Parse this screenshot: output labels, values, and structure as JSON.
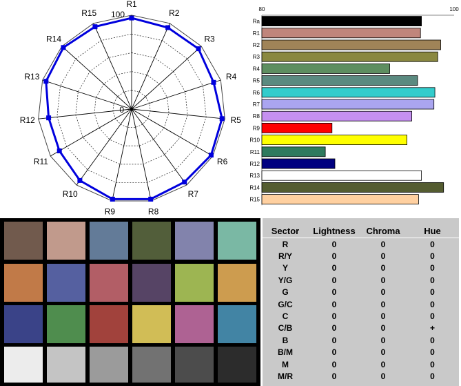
{
  "chart_data": [
    {
      "type": "radar",
      "axes": [
        "R1",
        "R2",
        "R3",
        "R4",
        "R5",
        "R6",
        "R7",
        "R8",
        "R9",
        "R10",
        "R11",
        "R12",
        "R13",
        "R14",
        "R15"
      ],
      "values": [
        97,
        95,
        96,
        92,
        97,
        98,
        96,
        98,
        98,
        94,
        89,
        89,
        96,
        98,
        96
      ],
      "max_label": "100",
      "center_label": "0",
      "range": [
        0,
        100
      ],
      "series_color": "#0000dd"
    },
    {
      "type": "bar",
      "orientation": "horizontal",
      "categories": [
        "Ra",
        "R1",
        "R2",
        "R3",
        "R4",
        "R5",
        "R6",
        "R7",
        "R8",
        "R9",
        "R10",
        "R11",
        "R12",
        "R13",
        "R14",
        "R15"
      ],
      "values": [
        96.6,
        96.5,
        98.6,
        98.3,
        93.3,
        96.2,
        98.0,
        97.9,
        95.6,
        87.3,
        95.1,
        86.6,
        87.6,
        96.6,
        98.9,
        96.3
      ],
      "colors": [
        "#000000",
        "#c0857b",
        "#a08458",
        "#8a8840",
        "#5e8e60",
        "#5b8a80",
        "#33cccc",
        "#aaa5f0",
        "#c590f0",
        "#ff0000",
        "#ffff00",
        "#2e7a5e",
        "#000080",
        "#ffffff",
        "#545c30",
        "#ffd0a0"
      ],
      "xlim": [
        80,
        100
      ],
      "tick_labels": [
        "80",
        "100"
      ]
    }
  ],
  "swatches": [
    "#715a4d",
    "#c19a8c",
    "#637b98",
    "#525e3a",
    "#8283ac",
    "#7ab8a4",
    "#c17a48",
    "#5560a0",
    "#b25e66",
    "#564465",
    "#9db552",
    "#cd9c4f",
    "#3a4388",
    "#4f8d4e",
    "#a1423c",
    "#d1bd56",
    "#ae6293",
    "#4284a4",
    "#ececec",
    "#c4c4c4",
    "#9b9b9b",
    "#727272",
    "#4c4c4c",
    "#2c2c2c"
  ],
  "sector_table": {
    "headers": [
      "Sector",
      "Lightness",
      "Chroma",
      "Hue"
    ],
    "rows": [
      [
        "R",
        "0",
        "0",
        "0"
      ],
      [
        "R/Y",
        "0",
        "0",
        "0"
      ],
      [
        "Y",
        "0",
        "0",
        "0"
      ],
      [
        "Y/G",
        "0",
        "0",
        "0"
      ],
      [
        "G",
        "0",
        "0",
        "0"
      ],
      [
        "G/C",
        "0",
        "0",
        "0"
      ],
      [
        "C",
        "0",
        "0",
        "0"
      ],
      [
        "C/B",
        "0",
        "0",
        "+"
      ],
      [
        "B",
        "0",
        "0",
        "0"
      ],
      [
        "B/M",
        "0",
        "0",
        "0"
      ],
      [
        "M",
        "0",
        "0",
        "0"
      ],
      [
        "M/R",
        "0",
        "0",
        "0"
      ]
    ]
  }
}
